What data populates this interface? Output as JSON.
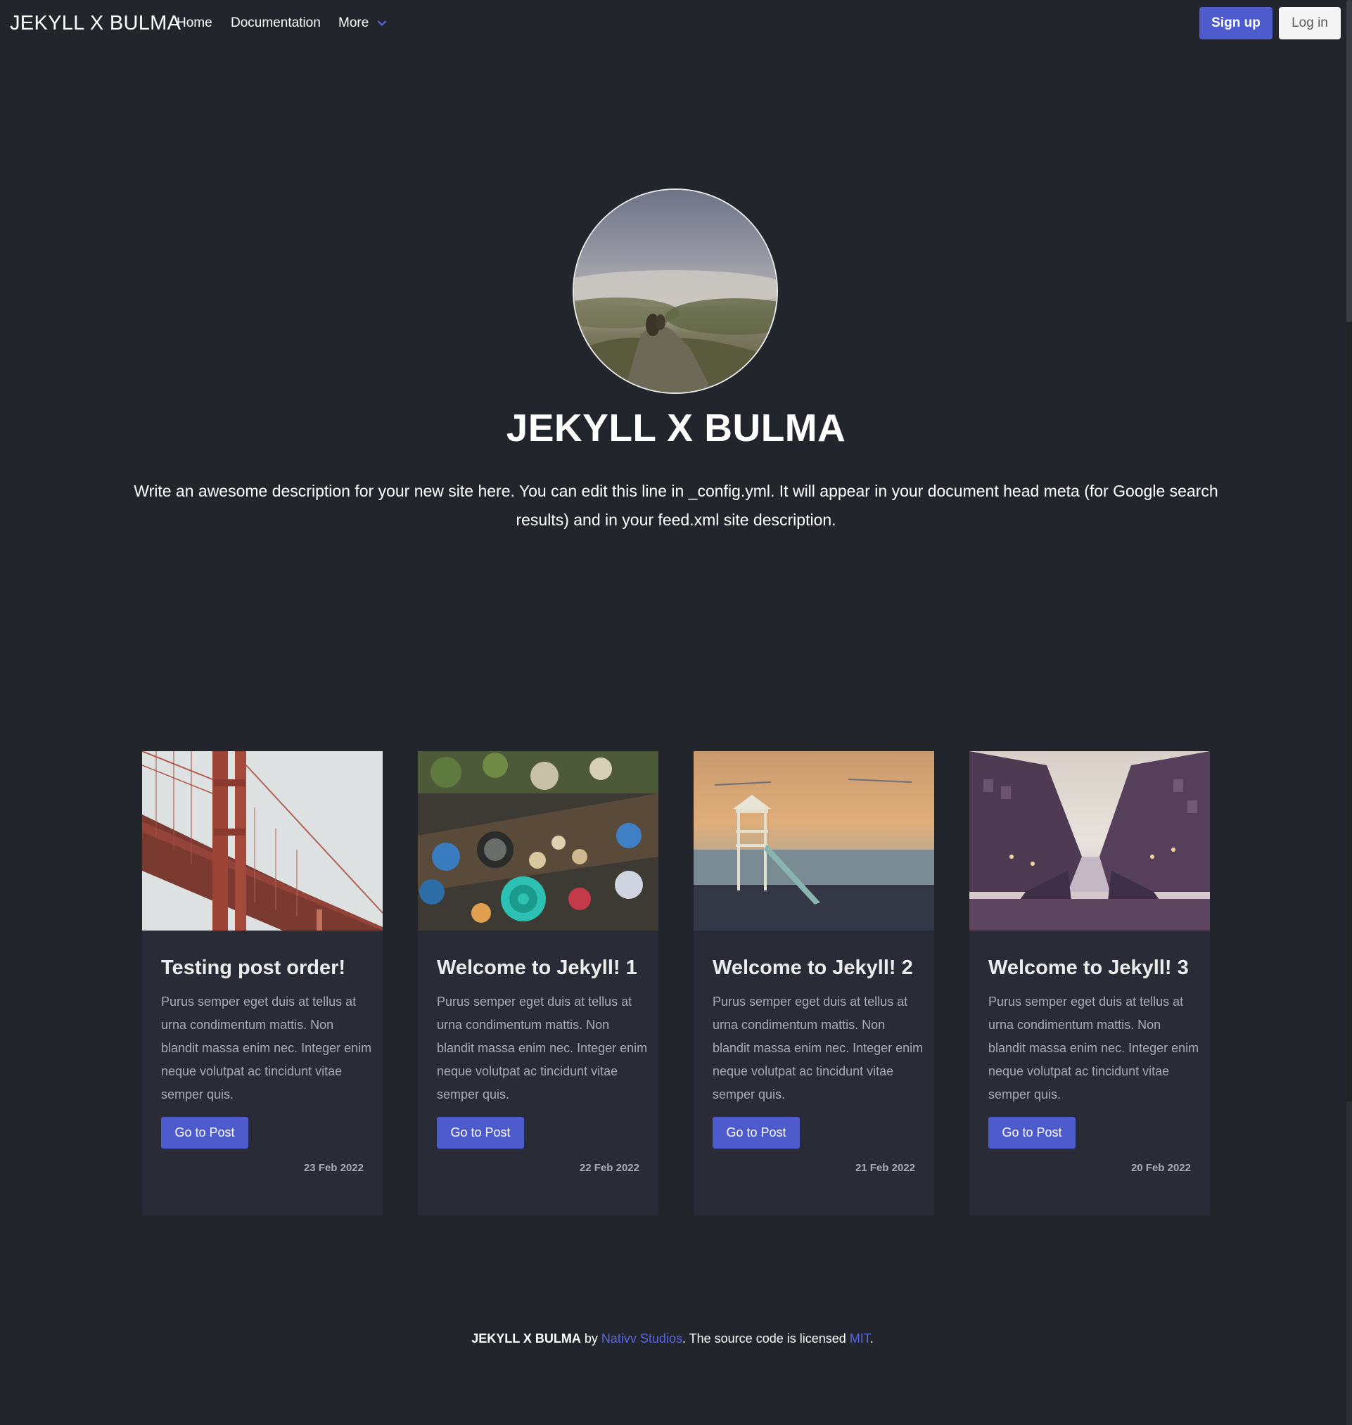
{
  "navbar": {
    "brand": "JEKYLL X BULMA",
    "items": [
      "Home",
      "Documentation",
      "More"
    ],
    "signup_label": "Sign up",
    "login_label": "Log in",
    "accent_color": "#4d5bcd"
  },
  "hero": {
    "title": "JEKYLL X BULMA",
    "description": "Write an awesome description for your new site here. You can edit this line in _config.yml. It will appear in your document head meta (for Google search results) and in your feed.xml site description."
  },
  "posts": [
    {
      "title": "Testing post order!",
      "excerpt": "Purus semper eget duis at tellus at urna condimentum mattis. Non blandit massa enim nec. Integer enim neque volutpat ac tincidunt vitae semper quis.",
      "button": "Go to Post",
      "date": "23 Feb 2022",
      "image": "golden-gate-bridge-photo"
    },
    {
      "title": "Welcome to Jekyll! 1",
      "excerpt": "Purus semper eget duis at tellus at urna condimentum mattis. Non blandit massa enim nec. Integer enim neque volutpat ac tincidunt vitae semper quis.",
      "button": "Go to Post",
      "date": "22 Feb 2022",
      "image": "floating-market-photo"
    },
    {
      "title": "Welcome to Jekyll! 2",
      "excerpt": "Purus semper eget duis at tellus at urna condimentum mattis. Non blandit massa enim nec. Integer enim neque volutpat ac tincidunt vitae semper quis.",
      "button": "Go to Post",
      "date": "21 Feb 2022",
      "image": "lifeguard-tower-photo"
    },
    {
      "title": "Welcome to Jekyll! 3",
      "excerpt": "Purus semper eget duis at tellus at urna condimentum mattis. Non blandit massa enim nec. Integer enim neque volutpat ac tincidunt vitae semper quis.",
      "button": "Go to Post",
      "date": "20 Feb 2022",
      "image": "canal-city-photo"
    }
  ],
  "footer": {
    "brand": "JEKYLL X BULMA",
    "by": " by ",
    "author_link": "Nativv Studios",
    "middle": ". The source code is licensed ",
    "license_link": "MIT",
    "end": "."
  }
}
